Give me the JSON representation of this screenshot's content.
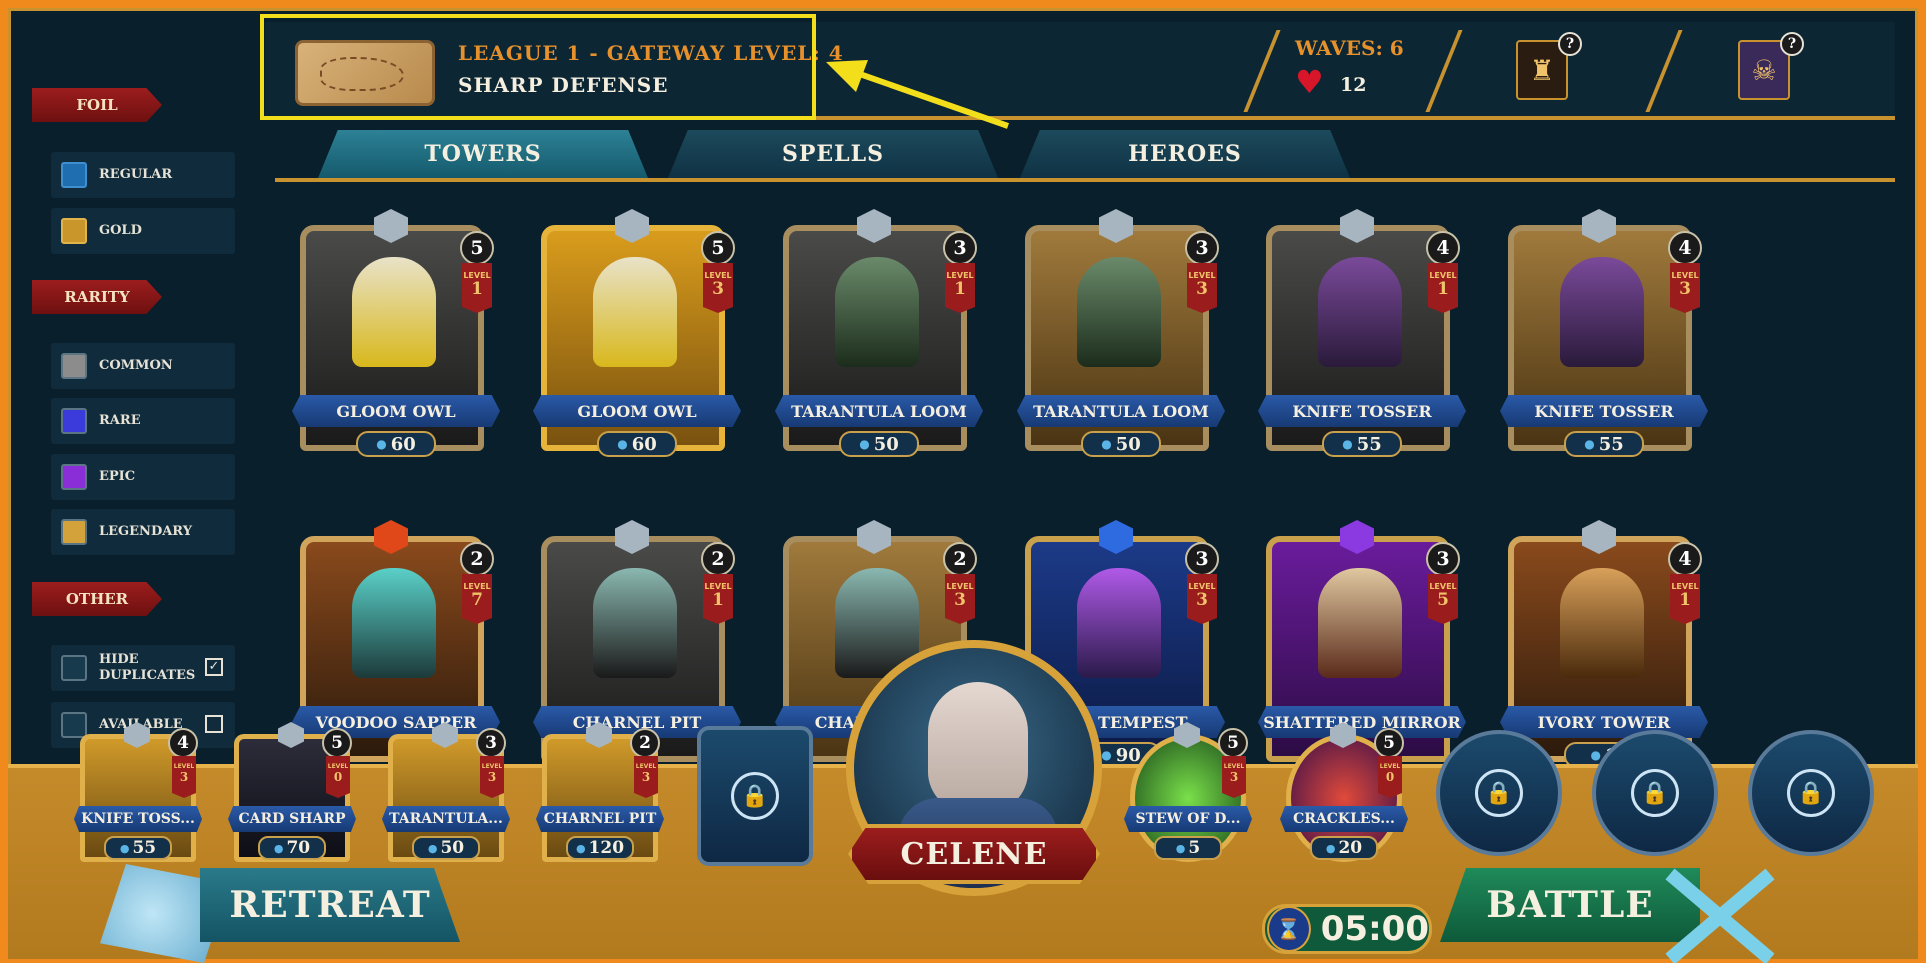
{
  "header": {
    "league": "LEAGUE 1 - GATEWAY LEVEL: 4",
    "mission": "SHARP DEFENSE",
    "waves": "WAVES: 6",
    "lives": "12",
    "help": "?"
  },
  "tabs": [
    {
      "label": "TOWERS",
      "active": true
    },
    {
      "label": "SPELLS",
      "active": false
    },
    {
      "label": "HEROES",
      "active": false
    }
  ],
  "sidebar": {
    "foil": {
      "title": "FOIL",
      "items": [
        {
          "label": "REGULAR",
          "color": "#1f6fb0"
        },
        {
          "label": "GOLD",
          "color": "#c9962c"
        }
      ]
    },
    "rarity": {
      "title": "RARITY",
      "items": [
        {
          "label": "COMMON",
          "color": "#8c8c8c"
        },
        {
          "label": "RARE",
          "color": "#3b3bdc"
        },
        {
          "label": "EPIC",
          "color": "#8a2ed8"
        },
        {
          "label": "LEGENDARY",
          "color": "#d4a23a"
        }
      ]
    },
    "other": {
      "title": "OTHER",
      "items": [
        {
          "label": "HIDE DUPLICATES",
          "checked": true
        },
        {
          "label": "AVAILABLE",
          "checked": false
        }
      ]
    }
  },
  "cards_row1": [
    {
      "name": "GLOOM OWL",
      "mana": "5",
      "level": "1",
      "cost": "60",
      "foil": "regular"
    },
    {
      "name": "GLOOM OWL",
      "mana": "5",
      "level": "3",
      "cost": "60",
      "foil": "gold"
    },
    {
      "name": "TARANTULA LOOM",
      "mana": "3",
      "level": "1",
      "cost": "50",
      "foil": "regular"
    },
    {
      "name": "TARANTULA LOOM",
      "mana": "3",
      "level": "3",
      "cost": "50",
      "foil": "goldbg"
    },
    {
      "name": "KNIFE TOSSER",
      "mana": "4",
      "level": "1",
      "cost": "55",
      "foil": "regular"
    },
    {
      "name": "KNIFE TOSSER",
      "mana": "4",
      "level": "3",
      "cost": "55",
      "foil": "goldbg"
    }
  ],
  "cards_row2": [
    {
      "name": "VOODOO SAPPER",
      "mana": "2",
      "level": "7",
      "rarity": "legendary"
    },
    {
      "name": "CHARNEL PIT",
      "mana": "2",
      "level": "1",
      "rarity": "common"
    },
    {
      "name": "CHARNEL PIT",
      "mana": "2",
      "level": "3",
      "rarity": "common"
    },
    {
      "name": "TED TEMPEST",
      "mana": "3",
      "level": "3",
      "cost": "90",
      "rarity": "rare"
    },
    {
      "name": "SHATTERED MIRROR",
      "mana": "3",
      "level": "5",
      "rarity": "epic"
    },
    {
      "name": "IVORY TOWER",
      "mana": "4",
      "level": "1",
      "cost": "1",
      "rarity": "legendary"
    }
  ],
  "level_word": "LEVEL",
  "deck": [
    {
      "name": "KNIFE TOSS...",
      "mana": "4",
      "level": "3",
      "cost": "55"
    },
    {
      "name": "CARD SHARP",
      "mana": "5",
      "level": "0",
      "cost": "70"
    },
    {
      "name": "TARANTULA...",
      "mana": "3",
      "level": "3",
      "cost": "50"
    },
    {
      "name": "CHARNEL PIT",
      "mana": "2",
      "level": "3",
      "cost": "120"
    }
  ],
  "spells": [
    {
      "name": "STEW OF D...",
      "mana": "5",
      "level": "3",
      "cost": "5"
    },
    {
      "name": "CRACKLES...",
      "mana": "5",
      "level": "0",
      "cost": "20"
    }
  ],
  "hero": {
    "name": "CELENE"
  },
  "buttons": {
    "retreat": "RETREAT",
    "battle": "BATTLE"
  },
  "timer": "05:00",
  "colors": {
    "highlight": "#f3de1c",
    "gold": "#c8922f",
    "background": "#0a1f2c",
    "outer": "#f08a1c"
  }
}
